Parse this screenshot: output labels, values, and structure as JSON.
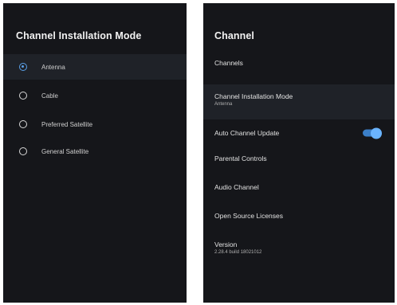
{
  "left_panel": {
    "title": "Channel Installation Mode",
    "options": [
      {
        "label": "Antenna",
        "selected": true
      },
      {
        "label": "Cable",
        "selected": false
      },
      {
        "label": "Preferred Satellite",
        "selected": false
      },
      {
        "label": "General Satellite",
        "selected": false
      }
    ]
  },
  "right_panel": {
    "title": "Channel",
    "items": [
      {
        "label": "Channels"
      },
      {
        "label": "Channel Installation Mode",
        "sub": "Antenna"
      },
      {
        "label": "Auto Channel Update",
        "toggle_on": true
      },
      {
        "label": "Parental Controls"
      },
      {
        "label": "Audio Channel"
      },
      {
        "label": "Open Source Licenses"
      },
      {
        "label": "Version",
        "sub": "2.28.4 build 18021012"
      }
    ]
  },
  "colors": {
    "panel_bg": "#15161a",
    "highlight_bg": "#1f2228",
    "accent": "#5aa0e8"
  }
}
